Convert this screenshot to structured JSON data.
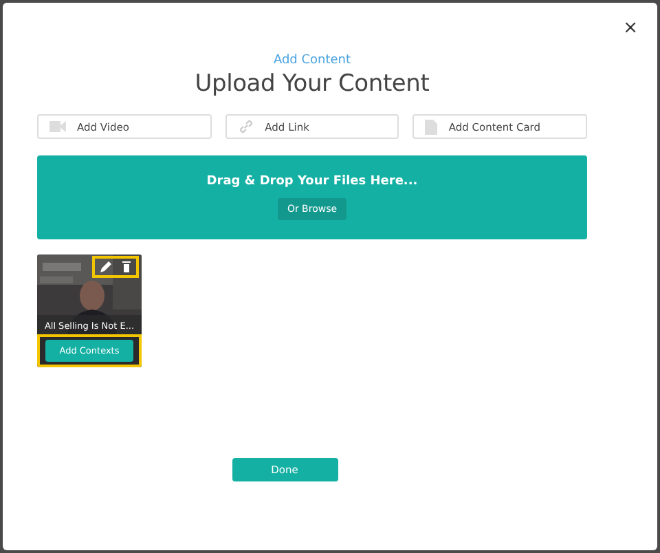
{
  "close_label": "×",
  "subtitle": "Add Content",
  "title": "Upload Your Content",
  "options": [
    {
      "kind": "video",
      "label": "Add Video"
    },
    {
      "kind": "link",
      "label": "Add Link"
    },
    {
      "kind": "card",
      "label": "Add Content Card"
    }
  ],
  "dropzone": {
    "text": "Drag & Drop Your Files Here...",
    "button": "Or Browse"
  },
  "items": [
    {
      "kind": "picture",
      "caption": "All Selling Is Not E...",
      "button": "Add Contexts"
    }
  ],
  "done_button": "Done"
}
